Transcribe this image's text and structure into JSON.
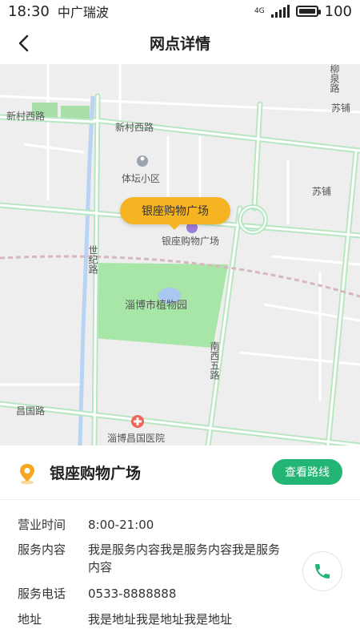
{
  "status_bar": {
    "time": "18:30",
    "carrier": "中广瑞波",
    "network": "4G",
    "battery": "100",
    "battery_level_pct": 100
  },
  "header": {
    "title": "网点详情"
  },
  "map": {
    "labels": {
      "xincun_west_road_1": "新村西路",
      "xincun_west_road_2": "新村西路",
      "liuquan_road": "柳泉路",
      "supu_1": "苏铺",
      "supu_2": "苏铺",
      "tiyuan_community": "体坛小区",
      "yinzuo_poi": "银座购物广场",
      "shiji_road": "世纪路",
      "botanical_garden": "淄博市植物园",
      "nanxiwu_road": "南西五路",
      "changguo_road": "昌国路",
      "hospital": "淄博昌国医院"
    },
    "callout": "银座购物广场"
  },
  "store": {
    "name": "银座购物广场",
    "route_button": "查看路线"
  },
  "details": {
    "hours_label": "营业时间",
    "hours": "8:00-21:00",
    "service_label": "服务内容",
    "service": "我是服务内容我是服务内容我是服务内容",
    "phone_label": "服务电话",
    "phone": "0533-8888888",
    "address_label": "地址",
    "address": "我是地址我是地址我是地址"
  },
  "colors": {
    "accent_green": "#22b573",
    "callout_yellow": "#f6b423",
    "pin_orange": "#f5a623"
  }
}
